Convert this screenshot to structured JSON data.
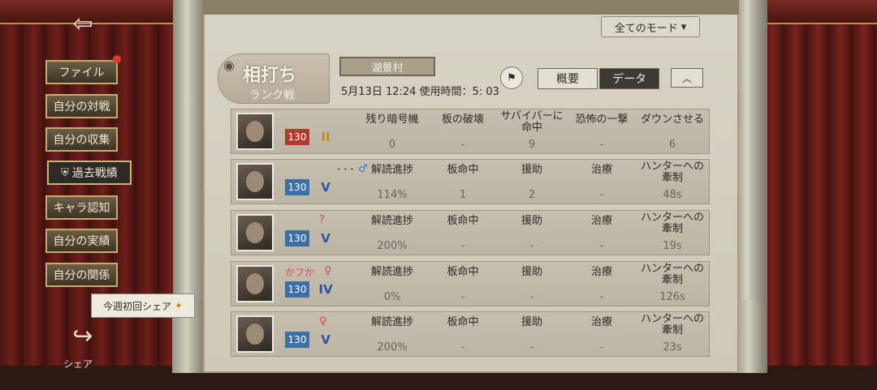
{
  "mode_select": {
    "label": "全てのモード",
    "arrow": "chevron-down-icon"
  },
  "header": {
    "title": "相打ち",
    "subtitle": "ランク戦",
    "map": "湖景村",
    "datetime": "5月13日  12:24 使用時間：5: 03",
    "tabs": [
      {
        "label": "概要",
        "active": false
      },
      {
        "label": "データ",
        "active": true
      }
    ],
    "collapse": "︿"
  },
  "sidebar": {
    "items": [
      {
        "label": "ファイル"
      },
      {
        "label": "自分の対戦"
      },
      {
        "label": "自分の収集"
      },
      {
        "label": "過去戦績",
        "active": true
      },
      {
        "label": "キャラ認知"
      },
      {
        "label": "自分の実績"
      },
      {
        "label": "自分の関係"
      }
    ],
    "share_tip": "今週初回シェア",
    "share_label": "シェア"
  },
  "rows": [
    {
      "name": "",
      "level": "130",
      "role": "hunter",
      "rank_badge": "II",
      "gender": "",
      "stats": [
        {
          "label": "残り暗号機",
          "value": "0"
        },
        {
          "label": "板の破壊",
          "value": "-"
        },
        {
          "label": "サバイバーに\n命中",
          "value": "9"
        },
        {
          "label": "恐怖の一撃",
          "value": "-"
        },
        {
          "label": "ダウンさせる",
          "value": "6"
        }
      ]
    },
    {
      "name": "- - -",
      "level": "130",
      "role": "survivor",
      "rank_badge": "V",
      "gender": "♂",
      "stats": [
        {
          "label": "解読進捗",
          "value": "114%"
        },
        {
          "label": "板命中",
          "value": "1"
        },
        {
          "label": "援助",
          "value": "2"
        },
        {
          "label": "治療",
          "value": "-"
        },
        {
          "label": "ハンターへの\n牽制",
          "value": "48s"
        }
      ]
    },
    {
      "name": "",
      "level": "130",
      "role": "survivor",
      "rank_badge": "V",
      "gender": "?",
      "stats": [
        {
          "label": "解読進捗",
          "value": "200%"
        },
        {
          "label": "板命中",
          "value": "-"
        },
        {
          "label": "援助",
          "value": "-"
        },
        {
          "label": "治療",
          "value": "-"
        },
        {
          "label": "ハンターへの\n牽制",
          "value": "19s"
        }
      ]
    },
    {
      "name": "かフか",
      "level": "130",
      "role": "survivor",
      "rank_badge": "IV",
      "gender": "♀",
      "stats": [
        {
          "label": "解読進捗",
          "value": "0%"
        },
        {
          "label": "板命中",
          "value": "-"
        },
        {
          "label": "援助",
          "value": "-"
        },
        {
          "label": "治療",
          "value": "-"
        },
        {
          "label": "ハンターへの\n牽制",
          "value": "126s"
        }
      ]
    },
    {
      "name": "",
      "level": "130",
      "role": "survivor",
      "rank_badge": "V",
      "gender": "♀",
      "stats": [
        {
          "label": "解読進捗",
          "value": "200%"
        },
        {
          "label": "板命中",
          "value": "-"
        },
        {
          "label": "援助",
          "value": "-"
        },
        {
          "label": "治療",
          "value": "-"
        },
        {
          "label": "ハンターへの\n牽制",
          "value": "23s"
        }
      ]
    }
  ],
  "colors": {
    "hunter_level": "#b13b2b",
    "survivor_level": "#3d6ea8",
    "active_tab": "#3d3a34",
    "notify": "#e03a2c"
  }
}
